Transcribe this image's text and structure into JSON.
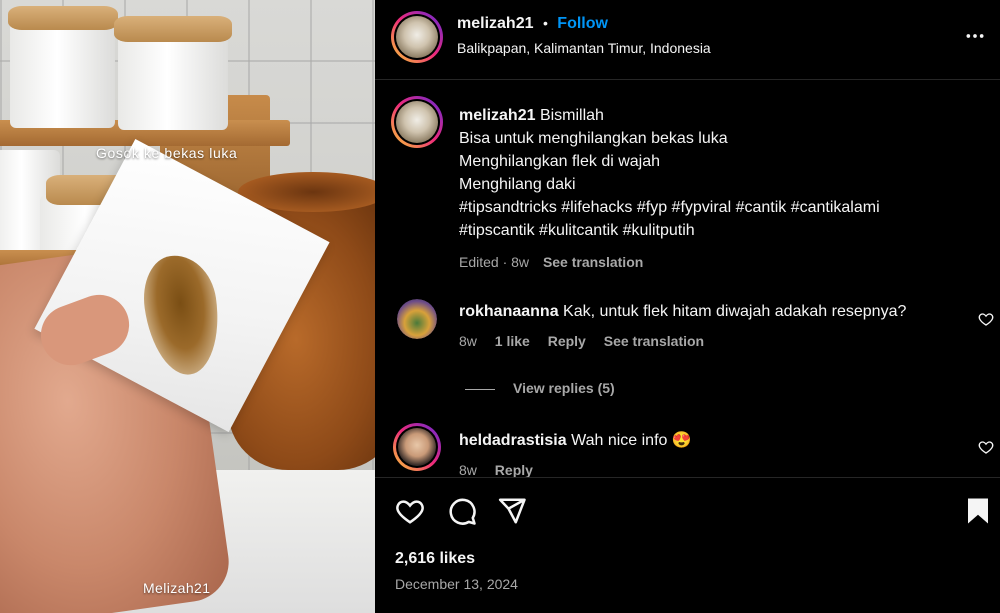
{
  "media": {
    "caption_overlay": "Gosok ke bekas luka",
    "watermark": "Melizah21"
  },
  "header": {
    "username": "melizah21",
    "separator": "•",
    "follow_label": "Follow",
    "location": "Balikpapan, Kalimantan Timur, Indonesia",
    "more_icon": "more-horizontal-icon"
  },
  "caption": {
    "username": "melizah21",
    "lines": [
      "Bismillah",
      "Bisa untuk menghilangkan bekas luka",
      "Menghilangkan flek di wajah",
      "Menghilang daki",
      "#tipsandtricks #lifehacks #fyp #fypviral #cantik #cantikalami",
      "#tipscantik #kulitcantik #kulitputih"
    ],
    "edited": "Edited · 8w",
    "see_translation": "See translation"
  },
  "comments": [
    {
      "username": "rokhanaanna",
      "text": "Kak, untuk flek hitam diwajah adakah resepnya?",
      "time": "8w",
      "likes": "1 like",
      "reply": "Reply",
      "see_translation": "See translation",
      "view_replies": "View replies (5)"
    },
    {
      "username": "heldadrastisia",
      "text": "Wah nice info 😍",
      "time": "8w",
      "reply": "Reply"
    }
  ],
  "actions": {
    "likes": "2,616 likes",
    "date": "December 13, 2024"
  },
  "colors": {
    "background": "#000000",
    "link_blue": "#0095f6",
    "muted": "#a8a8a8",
    "divider": "#262626"
  }
}
